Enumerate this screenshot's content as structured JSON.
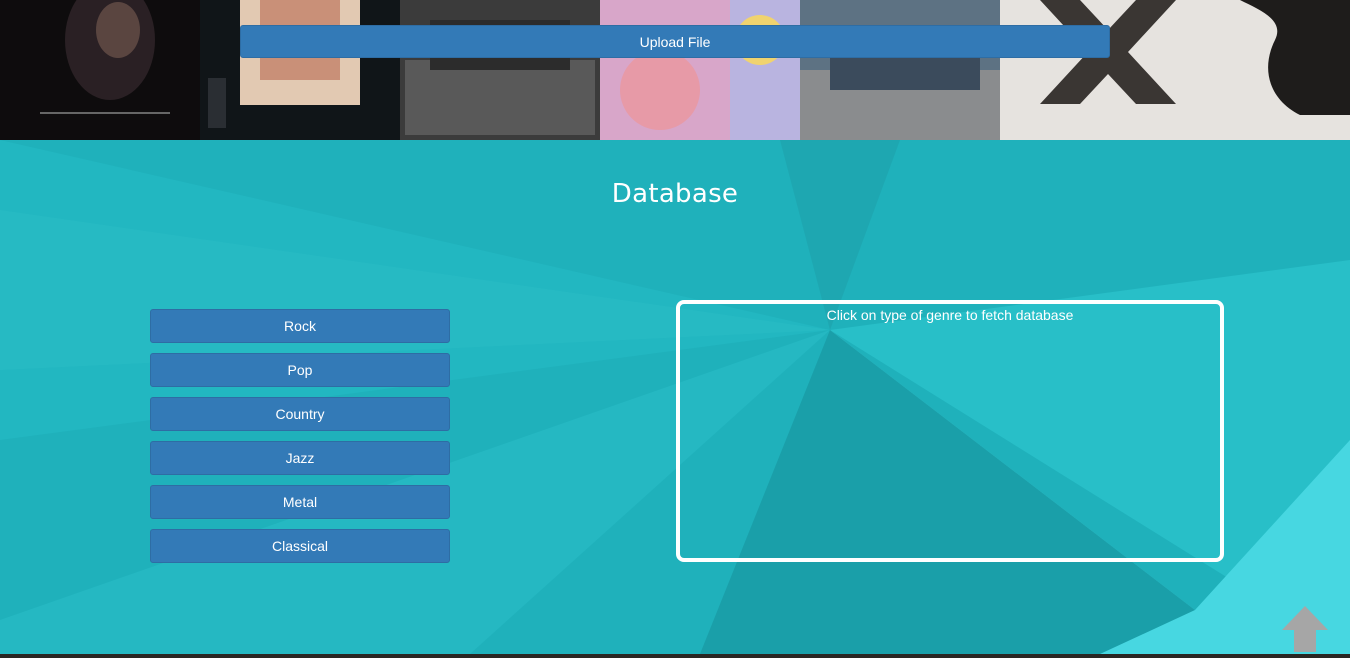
{
  "header": {
    "upload_label": "Upload File",
    "upload_icon": "upload-icon"
  },
  "database": {
    "title": "Database",
    "genres": [
      {
        "label": "Rock"
      },
      {
        "label": "Pop"
      },
      {
        "label": "Country"
      },
      {
        "label": "Jazz"
      },
      {
        "label": "Metal"
      },
      {
        "label": "Classical"
      }
    ],
    "result_placeholder": "Click on type of genre to fetch database"
  },
  "scroll_top": {
    "icon": "arrow-up-icon"
  },
  "colors": {
    "button": "#337ab7",
    "section_bg": "#1fb0ba",
    "arrow": "#a6a6a6"
  }
}
